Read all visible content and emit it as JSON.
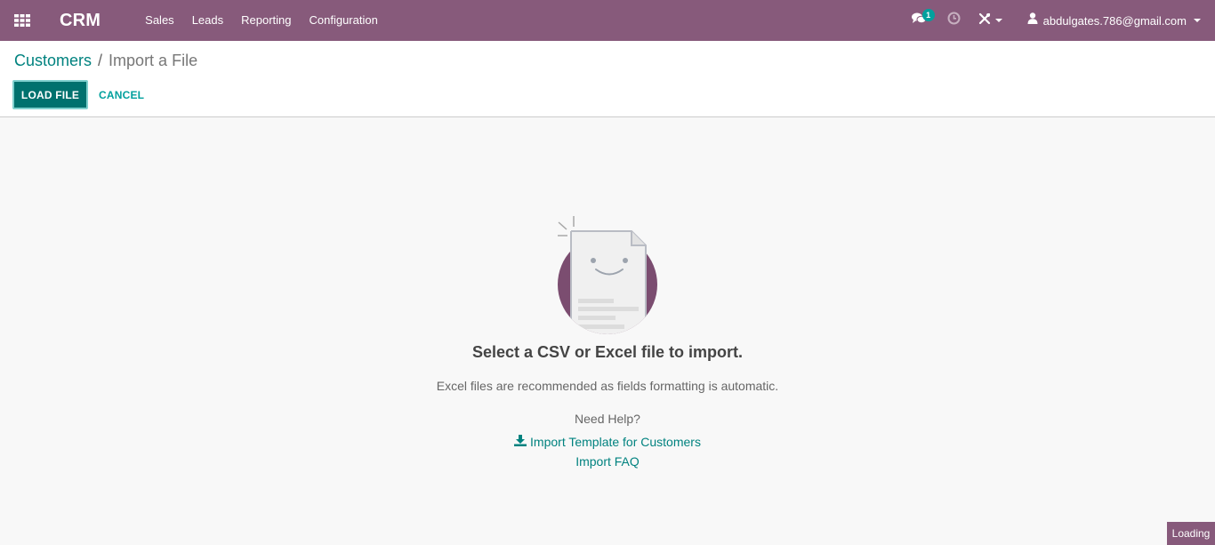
{
  "navbar": {
    "app_title": "CRM",
    "menu": [
      "Sales",
      "Leads",
      "Reporting",
      "Configuration"
    ],
    "messages_badge": "1",
    "user_email": "abdulgates.786@gmail.com",
    "bg_color": "#875a7b",
    "icons": [
      "apps-grid-icon",
      "chat-icon",
      "clock-icon",
      "debug-tools-icon",
      "user-icon"
    ]
  },
  "breadcrumb": {
    "parent": "Customers",
    "separator": "/",
    "current": "Import a File"
  },
  "buttons": {
    "load_file": "LOAD FILE",
    "cancel": "CANCEL",
    "primary_color": "#00716e"
  },
  "main": {
    "headline": "Select a CSV or Excel file to import.",
    "subtext": "Excel files are recommended as fields formatting is automatic.",
    "help_title": "Need Help?",
    "template_link": "Import Template for Customers",
    "faq_link": "Import FAQ",
    "link_color": "#00827f"
  },
  "status": {
    "loading": "Loading"
  }
}
